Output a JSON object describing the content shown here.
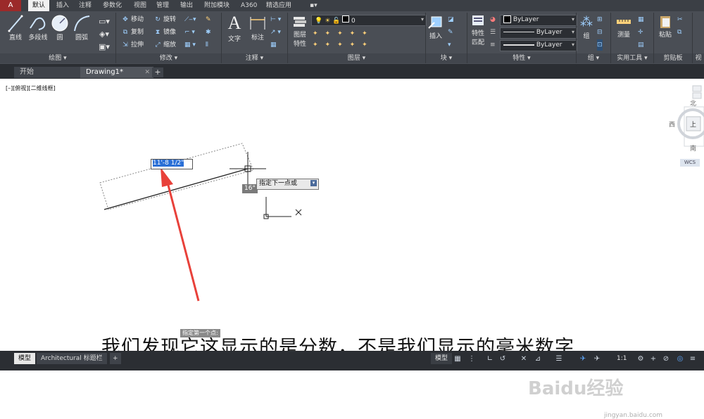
{
  "app_button": "A",
  "ribbon_tabs": [
    "默认",
    "插入",
    "注释",
    "参数化",
    "视图",
    "管理",
    "输出",
    "附加模块",
    "A360",
    "精选应用",
    "▪▾"
  ],
  "draw_panel": {
    "title": "绘图 ▾",
    "tools": [
      "直线",
      "多段线",
      "圆",
      "圆弧"
    ]
  },
  "modify_panel": {
    "title": "修改 ▾",
    "tools": [
      "移动",
      "旋转",
      "复制",
      "镜像",
      "拉伸",
      "缩放"
    ]
  },
  "annotation_panel": {
    "title": "注释 ▾",
    "tools": [
      "文字",
      "标注"
    ]
  },
  "layers_panel": {
    "title": "图层 ▾",
    "tools": [
      "图层",
      "特性"
    ],
    "layer_value": "0"
  },
  "block_panel": {
    "title": "块 ▾",
    "tools": [
      "插入"
    ]
  },
  "properties_panel": {
    "title": "特性 ▾",
    "tools": [
      "特性",
      "匹配"
    ],
    "color": "ByLayer",
    "linetype": "ByLayer",
    "lineweight": "ByLayer"
  },
  "group_panel": {
    "title": "组 ▾",
    "tools": [
      "组"
    ]
  },
  "utilities_panel": {
    "title": "实用工具 ▾",
    "tools": [
      "测量"
    ]
  },
  "clipboard_panel": {
    "title": "剪贴板",
    "tools": [
      "粘贴"
    ]
  },
  "view_panel_cut": "视",
  "doc_tabs": [
    {
      "label": "开始"
    },
    {
      "label": "Drawing1*",
      "close": "✕"
    }
  ],
  "new_tab": "+",
  "viewport_label": "[–][俯视][二维线框]",
  "dynamic_input_value": "11'-8 1/2\"",
  "angle_value": "16°",
  "tooltip_text": "指定下一点或",
  "tooltip_button": "▾",
  "viewcube": {
    "north": "北",
    "west": "西",
    "south": "南",
    "top": "上",
    "wcs": "WCS"
  },
  "prompt_label": "指定第一个点:",
  "subtitle": "我们发现它这显示的是分数，不是我们显示的毫米数字",
  "watermark": "Baidu经验",
  "watermark_sub": "jingyan.baidu.com",
  "status_tabs": [
    "模型",
    "Architectural 标题栏"
  ],
  "status_model": "模型",
  "status_scale": "1:1",
  "status_new": "+",
  "accent_color": "#2a6fd6",
  "annotation_arrow_color": "#e8413a"
}
